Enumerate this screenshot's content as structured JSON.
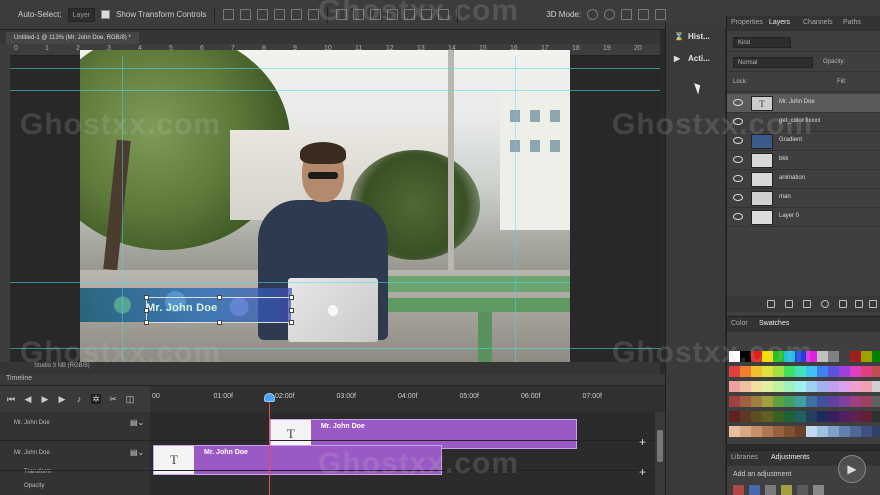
{
  "options_bar": {
    "auto_select_label": "Auto-Select:",
    "auto_select_value": "Layer",
    "show_transform_controls": "Show Transform Controls",
    "mode_3d_label": "3D Mode:"
  },
  "document": {
    "tab_title": "Untitled-1 @ 113% (Mr. John Doe, RGB/8) *"
  },
  "ruler_ticks": [
    "0",
    "1",
    "2",
    "3",
    "4",
    "5",
    "6",
    "7",
    "8",
    "9",
    "10",
    "11",
    "12",
    "13",
    "14",
    "15",
    "16",
    "17",
    "18",
    "19",
    "20"
  ],
  "canvas": {
    "lower_third_text": "Mr. John Doe"
  },
  "status": {
    "readout": "Studio 3 NB (RGB/8)"
  },
  "timeline": {
    "title": "Timeline",
    "timecodes": [
      "00",
      "01:00f",
      "02:00f",
      "03:00f",
      "04:00f",
      "05:00f",
      "06:00f",
      "07:00f"
    ],
    "playhead_time_seconds": 1.9,
    "rows": [
      {
        "label": "Mr. John Doe"
      },
      {
        "label": "Mr. John Doe"
      },
      {
        "label": "Transform"
      },
      {
        "label": "Opacity"
      }
    ],
    "clips": [
      {
        "label": "Mr. John Doe",
        "thumb": "T",
        "start_s": 1.9,
        "end_s": 6.9
      },
      {
        "label": "Mr. John Doe",
        "thumb": "T",
        "start_s": 0.0,
        "end_s": 4.7
      }
    ]
  },
  "mini_dock": {
    "history": "Hist...",
    "actions": "Acti..."
  },
  "layers_panel": {
    "tabs": [
      "Properties",
      "Layers",
      "Channels",
      "Paths"
    ],
    "active_tab": "Layers",
    "filter_kind": "Kind",
    "blend_mode": "Normal",
    "opacity_label": "Opacity:",
    "lock_label": "Lock:",
    "fill_label": "Fill:",
    "layers": [
      {
        "name": "Mr. John Doe",
        "thumb": "T",
        "selected": true
      },
      {
        "name": "get_color fixxxx",
        "thumb": "",
        "selected": false
      },
      {
        "name": "Gradient",
        "thumb": "",
        "selected": false
      },
      {
        "name": "bkk",
        "thumb": "",
        "selected": false
      },
      {
        "name": "animation",
        "thumb": "",
        "selected": false
      },
      {
        "name": "man",
        "thumb": "",
        "selected": false
      },
      {
        "name": "Layer 0",
        "thumb": "",
        "selected": false
      }
    ]
  },
  "swatches_panel": {
    "tabs": [
      "Color",
      "Swatches"
    ],
    "active_tab": "Swatches"
  },
  "libraries_panel": {
    "tabs": [
      "Libraries",
      "Adjustments"
    ],
    "add_adjustment": "Add an adjustment"
  },
  "watermark": "Ghostxx.com",
  "colors": {
    "clip": "#9b59c6",
    "playhead": "#e84b5a",
    "guides": "#50dcf0"
  }
}
